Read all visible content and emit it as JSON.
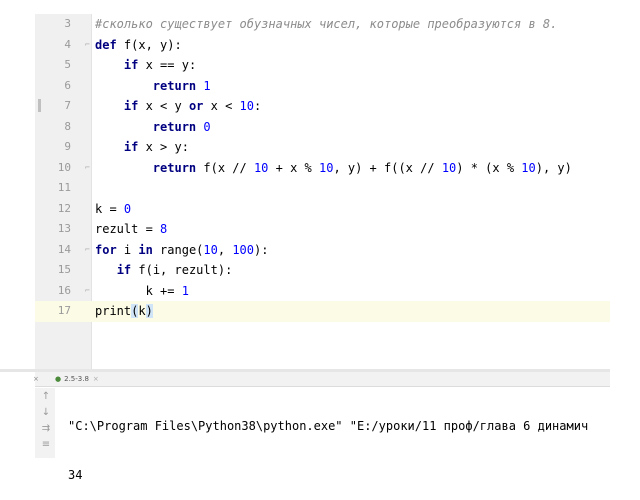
{
  "editor": {
    "lines": [
      {
        "n": "3",
        "tokens": [
          {
            "t": "#сколько существует обузначных чисел, которые преобразуются в 8.",
            "c": "cmt"
          }
        ]
      },
      {
        "n": "4",
        "fold": true,
        "tokens": [
          {
            "t": "def ",
            "c": "kw"
          },
          {
            "t": "f(x, y):"
          }
        ]
      },
      {
        "n": "5",
        "tokens": [
          {
            "t": "    "
          },
          {
            "t": "if ",
            "c": "kw"
          },
          {
            "t": "x == y:"
          }
        ]
      },
      {
        "n": "6",
        "tokens": [
          {
            "t": "        "
          },
          {
            "t": "return ",
            "c": "kw"
          },
          {
            "t": "1",
            "c": "num"
          }
        ]
      },
      {
        "n": "7",
        "bookmark": true,
        "tokens": [
          {
            "t": "    "
          },
          {
            "t": "if ",
            "c": "kw"
          },
          {
            "t": "x < y "
          },
          {
            "t": "or ",
            "c": "kw"
          },
          {
            "t": "x < "
          },
          {
            "t": "10",
            "c": "num"
          },
          {
            "t": ":"
          }
        ]
      },
      {
        "n": "8",
        "tokens": [
          {
            "t": "        "
          },
          {
            "t": "return ",
            "c": "kw"
          },
          {
            "t": "0",
            "c": "num"
          }
        ]
      },
      {
        "n": "9",
        "tokens": [
          {
            "t": "    "
          },
          {
            "t": "if ",
            "c": "kw"
          },
          {
            "t": "x > y:"
          }
        ]
      },
      {
        "n": "10",
        "fold": true,
        "tokens": [
          {
            "t": "        "
          },
          {
            "t": "return ",
            "c": "kw"
          },
          {
            "t": "f(x // "
          },
          {
            "t": "10",
            "c": "num"
          },
          {
            "t": " + x % "
          },
          {
            "t": "10",
            "c": "num"
          },
          {
            "t": ", y) + f((x // "
          },
          {
            "t": "10",
            "c": "num"
          },
          {
            "t": ") * (x % "
          },
          {
            "t": "10",
            "c": "num"
          },
          {
            "t": "), y)"
          }
        ]
      },
      {
        "n": "11",
        "tokens": []
      },
      {
        "n": "12",
        "tokens": [
          {
            "t": "k = "
          },
          {
            "t": "0",
            "c": "num"
          }
        ]
      },
      {
        "n": "13",
        "tokens": [
          {
            "t": "rezult = "
          },
          {
            "t": "8",
            "c": "num"
          }
        ]
      },
      {
        "n": "14",
        "fold": true,
        "tokens": [
          {
            "t": "for ",
            "c": "kw"
          },
          {
            "t": "i "
          },
          {
            "t": "in ",
            "c": "kw"
          },
          {
            "t": "range("
          },
          {
            "t": "10",
            "c": "num"
          },
          {
            "t": ", "
          },
          {
            "t": "100",
            "c": "num"
          },
          {
            "t": "):"
          }
        ]
      },
      {
        "n": "15",
        "tokens": [
          {
            "t": "   "
          },
          {
            "t": "if ",
            "c": "kw"
          },
          {
            "t": "f(i, rezult):"
          }
        ]
      },
      {
        "n": "16",
        "fold": true,
        "tokens": [
          {
            "t": "       k += "
          },
          {
            "t": "1",
            "c": "num"
          }
        ]
      },
      {
        "n": "17",
        "current": true,
        "tokens": [
          {
            "t": "print"
          },
          {
            "t": "(",
            "c": "hl"
          },
          {
            "t": "k"
          },
          {
            "t": ")",
            "c": "hl"
          }
        ]
      }
    ]
  },
  "run": {
    "tab_label": "2.5-3.8",
    "left_close": "×",
    "output_lines": [
      "\"C:\\Program Files\\Python38\\python.exe\" \"E:/уроки/11 проф/глава 6 динамич",
      "34"
    ]
  },
  "icons": [
    "up-arrow-icon",
    "down-arrow-icon",
    "soft-wrap-icon",
    "scroll-to-end-icon"
  ],
  "colors": {
    "keyword": "#000080",
    "number": "#0000ff",
    "comment": "#8c8c8c",
    "current_line": "#fcfbe6",
    "bracket_highlight": "#cfe4f7"
  }
}
